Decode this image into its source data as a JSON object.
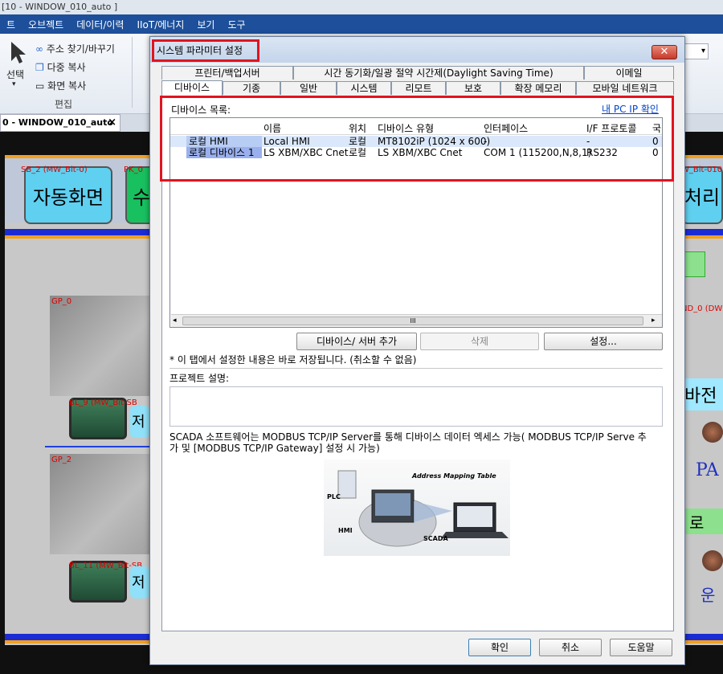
{
  "app": {
    "title": "[10 - WINDOW_010_auto ]"
  },
  "menu": [
    "트",
    "오브젝트",
    "데이터/이력",
    "IIoT/에너지",
    "보기",
    "도구"
  ],
  "ribbon": {
    "select_label": "선택",
    "find_replace": "주소 찾기/바꾸기",
    "multi_copy": "다중 복사",
    "screen_copy": "화면 복사",
    "group_edit": "편집"
  },
  "doc_tab": {
    "label": "0 - WINDOW_010_auto",
    "close": "×"
  },
  "canvas": {
    "btn_auto": "자동화면",
    "btn_partial": "수",
    "btn_process": "처리",
    "lbl_sb2": "SB_2 (MW_Bit-0)",
    "lbl_pk": "PK_0",
    "lbl_right_top": "W_Bit-010",
    "lbl_gp0": "GP_0",
    "lbl_gp2": "GP_2",
    "lbl_bl9": "BL_9 (MW_Bit-SB",
    "lbl_bl11": "BL_11 (MW_Bit-SB",
    "lbl_nd0": "ND_0 (DW",
    "lbl_right_mid": "바전",
    "lbl_pa": "PA",
    "lbl_ro": "로",
    "lbl_un": "운",
    "small_jeo": "저"
  },
  "dialog": {
    "title": "시스템 파라미터 설정",
    "close": "✕",
    "tabs_row1": [
      "프린터/백업서버",
      "시간 동기화/일광 절약 시간제(Daylight Saving Time)",
      "이메일"
    ],
    "tabs_row2": [
      "디바이스",
      "기종",
      "일반",
      "시스템",
      "리모트",
      "보호",
      "확장 메모리",
      "모바일 네트워크"
    ],
    "device_list_label": "디바이스 목록:",
    "my_pc_ip": "내 PC IP 확인",
    "columns": [
      "이름",
      "위치",
      "디바이스 유형",
      "인터페이스",
      "I/F 프로토콜",
      "국"
    ],
    "rows": [
      {
        "group": "로컬 HMI",
        "name": "Local HMI",
        "loc": "로컬",
        "type": "MT8102iP (1024 x 600)",
        "iface": "-",
        "proto": "-",
        "station": "0"
      },
      {
        "group": "로컬 디바이스 1",
        "name": "LS XBM/XBC Cnet",
        "loc": "로컬",
        "type": "LS XBM/XBC Cnet",
        "iface": "COM 1 (115200,N,8,1)",
        "proto": "RS232",
        "station": "0"
      }
    ],
    "scroll_thumb": "III",
    "btn_add": "디바이스/ 서버 추가",
    "btn_delete": "삭제",
    "btn_settings": "설정...",
    "save_note": "* 이 탭에서 설정한 내용은 바로 저장됩니다. (취소할 수 없음)",
    "project_desc_label": "프로젝트 설명:",
    "scada_line1": "SCADA 소프트웨어는 MODBUS TCP/IP Server를 통해 디바이스 데이터 엑세스 가능( MODBUS TCP/IP Serve 추",
    "scada_line2": "가 및 [MODBUS TCP/IP Gateway] 설정 시 가능)",
    "diagram": {
      "title": "Address Mapping Table",
      "plc": "PLC",
      "hmi": "HMI",
      "scada": "SCADA"
    },
    "btn_ok": "확인",
    "btn_cancel": "취소",
    "btn_help": "도움말"
  }
}
